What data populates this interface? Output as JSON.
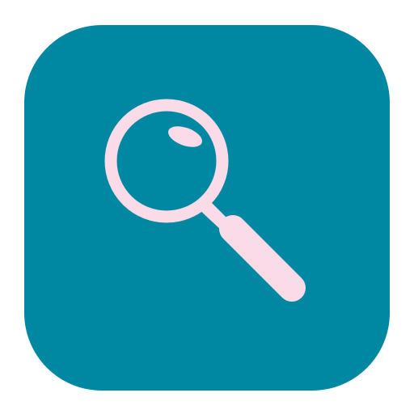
{
  "icon": {
    "name": "search-app-icon",
    "glyph": "magnifying-glass-icon",
    "background_color": "#0088a2",
    "glyph_color": "#fcdbe8"
  }
}
